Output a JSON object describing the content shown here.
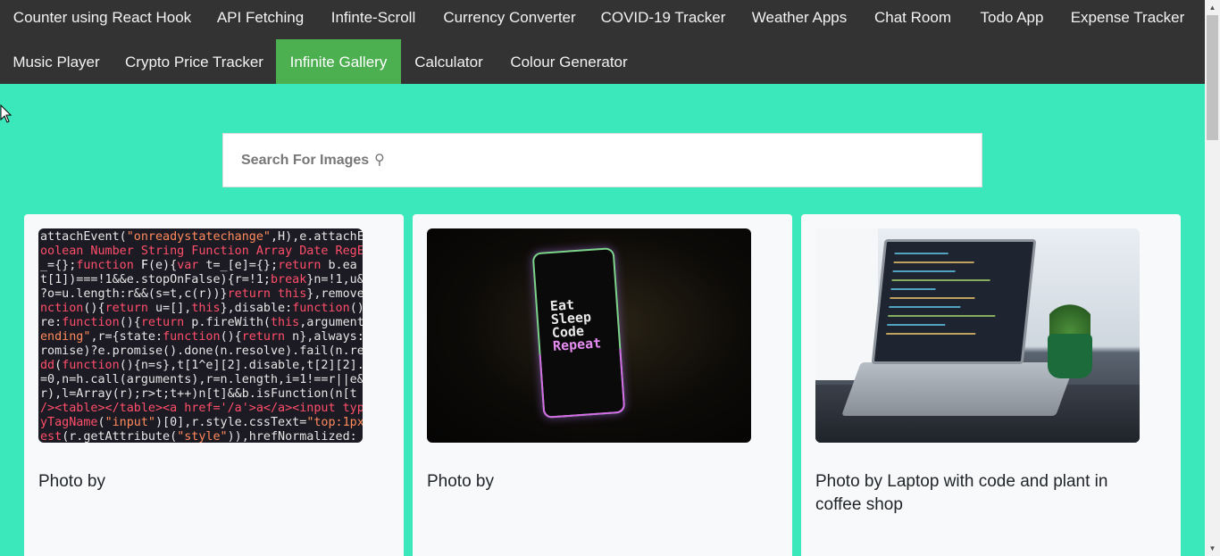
{
  "nav": {
    "items": [
      {
        "label": "Counter using React Hook"
      },
      {
        "label": "API Fetching"
      },
      {
        "label": "Infinte-Scroll"
      },
      {
        "label": "Currency Converter"
      },
      {
        "label": "COVID-19 Tracker"
      },
      {
        "label": "Weather Apps"
      },
      {
        "label": "Chat Room"
      },
      {
        "label": "Todo App"
      },
      {
        "label": "Expense Tracker"
      },
      {
        "label": "Music Player"
      },
      {
        "label": "Crypto Price Tracker"
      },
      {
        "label": "Infinite Gallery",
        "active": true
      },
      {
        "label": "Calculator"
      },
      {
        "label": "Colour Generator"
      }
    ]
  },
  "search": {
    "placeholder": "Search For Images",
    "icon": "magnifier-icon"
  },
  "gallery": {
    "cards": [
      {
        "caption": "Photo by",
        "image": "code-screenshot-image"
      },
      {
        "caption": "Photo by",
        "image": "phone-eat-sleep-code-repeat-image",
        "phone_text": [
          "Eat",
          "Sleep",
          "Code",
          "Repeat"
        ]
      },
      {
        "caption": "Photo by Laptop with code and plant in coffee shop",
        "image": "laptop-plant-image"
      }
    ]
  },
  "colors": {
    "page_bg": "#3be8bb",
    "nav_bg": "#333333",
    "nav_active": "#4caf50",
    "card_bg": "#f8f9fa"
  }
}
